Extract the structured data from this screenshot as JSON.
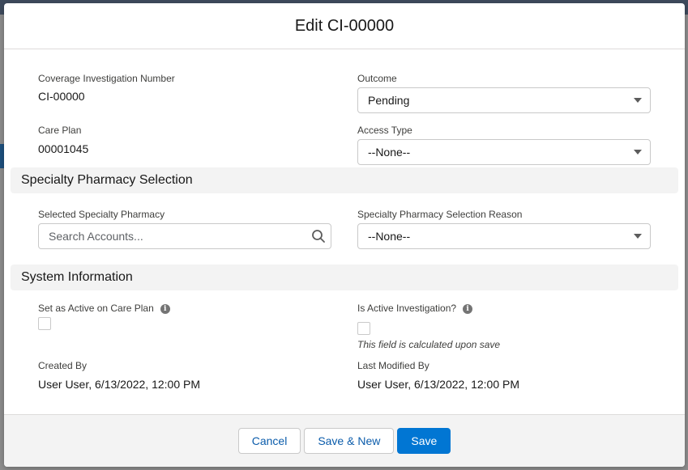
{
  "modal": {
    "title": "Edit CI-00000"
  },
  "fields": {
    "coverage_investigation_number": {
      "label": "Coverage Investigation Number",
      "value": "CI-00000"
    },
    "outcome": {
      "label": "Outcome",
      "value": "Pending"
    },
    "care_plan": {
      "label": "Care Plan",
      "value": "00001045"
    },
    "access_type": {
      "label": "Access Type",
      "value": "--None--"
    }
  },
  "sections": {
    "specialty_pharmacy": {
      "title": "Specialty Pharmacy Selection",
      "selected_pharmacy": {
        "label": "Selected Specialty Pharmacy",
        "placeholder": "Search Accounts..."
      },
      "selection_reason": {
        "label": "Specialty Pharmacy Selection Reason",
        "value": "--None--"
      }
    },
    "system_information": {
      "title": "System Information",
      "set_active": {
        "label": "Set as Active on Care Plan",
        "checked": false
      },
      "is_active": {
        "label": "Is Active Investigation?",
        "checked": false,
        "help": "This field is calculated upon save"
      },
      "created_by": {
        "label": "Created By",
        "value": "User User, 6/13/2022, 12:00 PM"
      },
      "last_modified_by": {
        "label": "Last Modified By",
        "value": "User User, 6/13/2022, 12:00 PM"
      }
    }
  },
  "footer": {
    "cancel_label": "Cancel",
    "save_new_label": "Save & New",
    "save_label": "Save"
  },
  "colors": {
    "brand": "#0176d3",
    "section_bg": "#f3f3f3",
    "neutral_text": "#0b5cab"
  },
  "icons": {
    "search": "search-icon",
    "info": "info-icon",
    "dropdown": "chevron-down-icon"
  }
}
